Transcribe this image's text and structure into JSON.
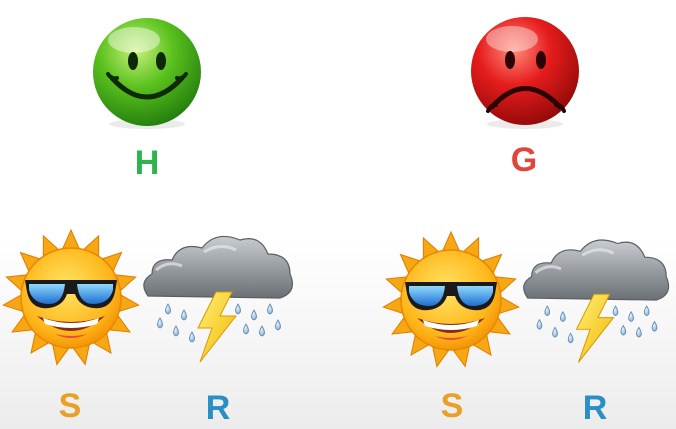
{
  "states": {
    "happy": {
      "label": "H",
      "color": "#2fb34f"
    },
    "grumpy": {
      "label": "G",
      "color": "#e2463a"
    }
  },
  "weather": {
    "left": {
      "sun": {
        "label": "S",
        "color": "#e8a025"
      },
      "rain": {
        "label": "R",
        "color": "#2a8fc4"
      }
    },
    "right": {
      "sun": {
        "label": "S",
        "color": "#e8a025"
      },
      "rain": {
        "label": "R",
        "color": "#2a8fc4"
      }
    }
  }
}
